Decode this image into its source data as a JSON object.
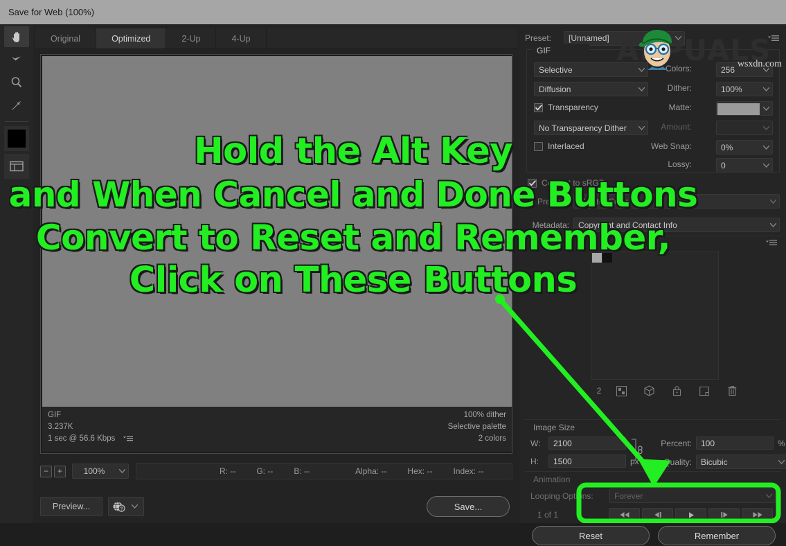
{
  "window": {
    "title": "Save for Web (100%)"
  },
  "tools": [
    {
      "name": "hand-tool",
      "icon": "hand-icon",
      "active": true
    },
    {
      "name": "slice-select-tool",
      "icon": "slice-select-icon",
      "active": false
    },
    {
      "name": "zoom-tool",
      "icon": "magnifier-icon",
      "active": false
    },
    {
      "name": "eyedropper-tool",
      "icon": "eyedropper-icon",
      "active": false
    }
  ],
  "toolbar_colors": {
    "foreground": "#000000"
  },
  "tabs": [
    {
      "label": "Original",
      "selected": false
    },
    {
      "label": "Optimized",
      "selected": true
    },
    {
      "label": "2-Up",
      "selected": false
    },
    {
      "label": "4-Up",
      "selected": false
    }
  ],
  "canvas": {
    "background_color": "#808080",
    "info_left": [
      "GIF",
      "3.237K",
      "1 sec @ 56.6 Kbps"
    ],
    "info_right": [
      "100% dither",
      "Selective palette",
      "2 colors"
    ]
  },
  "statusbar": {
    "zoom_out_label": "−",
    "zoom_in_label": "+",
    "zoom_value": "100%",
    "readout": [
      {
        "label": "R:",
        "value": "--"
      },
      {
        "label": "G:",
        "value": "--"
      },
      {
        "label": "B:",
        "value": "--"
      }
    ],
    "readout_extra": [
      {
        "label": "Alpha:",
        "value": "--"
      },
      {
        "label": "Hex:",
        "value": "--"
      },
      {
        "label": "Index:",
        "value": "--"
      }
    ]
  },
  "bottom_buttons": {
    "preview_label": "Preview...",
    "browser_icon": "globe-question-icon",
    "save_label": "Save..."
  },
  "settings": {
    "preset_label": "Preset:",
    "preset_value": "[Unnamed]",
    "format": "GIF",
    "reduction_algorithm": "Selective",
    "dither_algorithm": "Diffusion",
    "transparency_label": "Transparency",
    "transparency_checked": true,
    "transparency_dither": "No Transparency Dither",
    "interlaced_label": "Interlaced",
    "interlaced_checked": false,
    "colors_label": "Colors:",
    "colors_value": "256",
    "dither_label": "Dither:",
    "dither_value": "100%",
    "matte_label": "Matte:",
    "matte_color": "#9b9b9b",
    "amount_label": "Amount:",
    "amount_value": "",
    "websnap_label": "Web Snap:",
    "websnap_value": "0%",
    "lossy_label": "Lossy:",
    "lossy_value": "0",
    "srgb_label": "Convert to sRGB",
    "srgb_checked": true,
    "preview_label": "Preview:",
    "preview_value": "Monitor Color",
    "metadata_label": "Metadata:",
    "metadata_value": "Copyright and Contact Info"
  },
  "color_table": {
    "swatches": [
      "#a8a8a8",
      "#111111"
    ],
    "count": "2",
    "icons": [
      "transparency-icon",
      "web-shift-icon",
      "lock-icon",
      "new-swatch-icon",
      "trash-icon"
    ]
  },
  "image_size": {
    "title": "Image Size",
    "w_label": "W:",
    "w_value": "2100",
    "h_label": "H:",
    "h_value": "1500",
    "unit": "px",
    "percent_label": "Percent:",
    "percent_value": "100",
    "percent_unit": "%",
    "quality_label": "Quality:",
    "quality_value": "Bicubic",
    "chain_icon": "chain-link-icon"
  },
  "animation": {
    "title": "Animation",
    "loop_label": "Looping Options:",
    "loop_value": "Forever",
    "frame_counter": "1 of 1",
    "playback": [
      {
        "name": "first-frame-button",
        "icon": "◀◀"
      },
      {
        "name": "previous-frame-button",
        "icon": "◀❘"
      },
      {
        "name": "play-button",
        "icon": "▶"
      },
      {
        "name": "next-frame-button",
        "icon": "❘▶"
      },
      {
        "name": "last-frame-button",
        "icon": "▶▶"
      }
    ],
    "reset_label": "Reset",
    "remember_label": "Remember"
  },
  "annotation": {
    "color": "#22ee22",
    "lines": [
      "Hold the Alt Key",
      "and When Cancel and Done Buttons",
      "Convert to Reset and Remember,",
      "Click on These Buttons"
    ]
  },
  "watermark": {
    "brand": "APPUALS",
    "site": "wsxdn.com"
  }
}
